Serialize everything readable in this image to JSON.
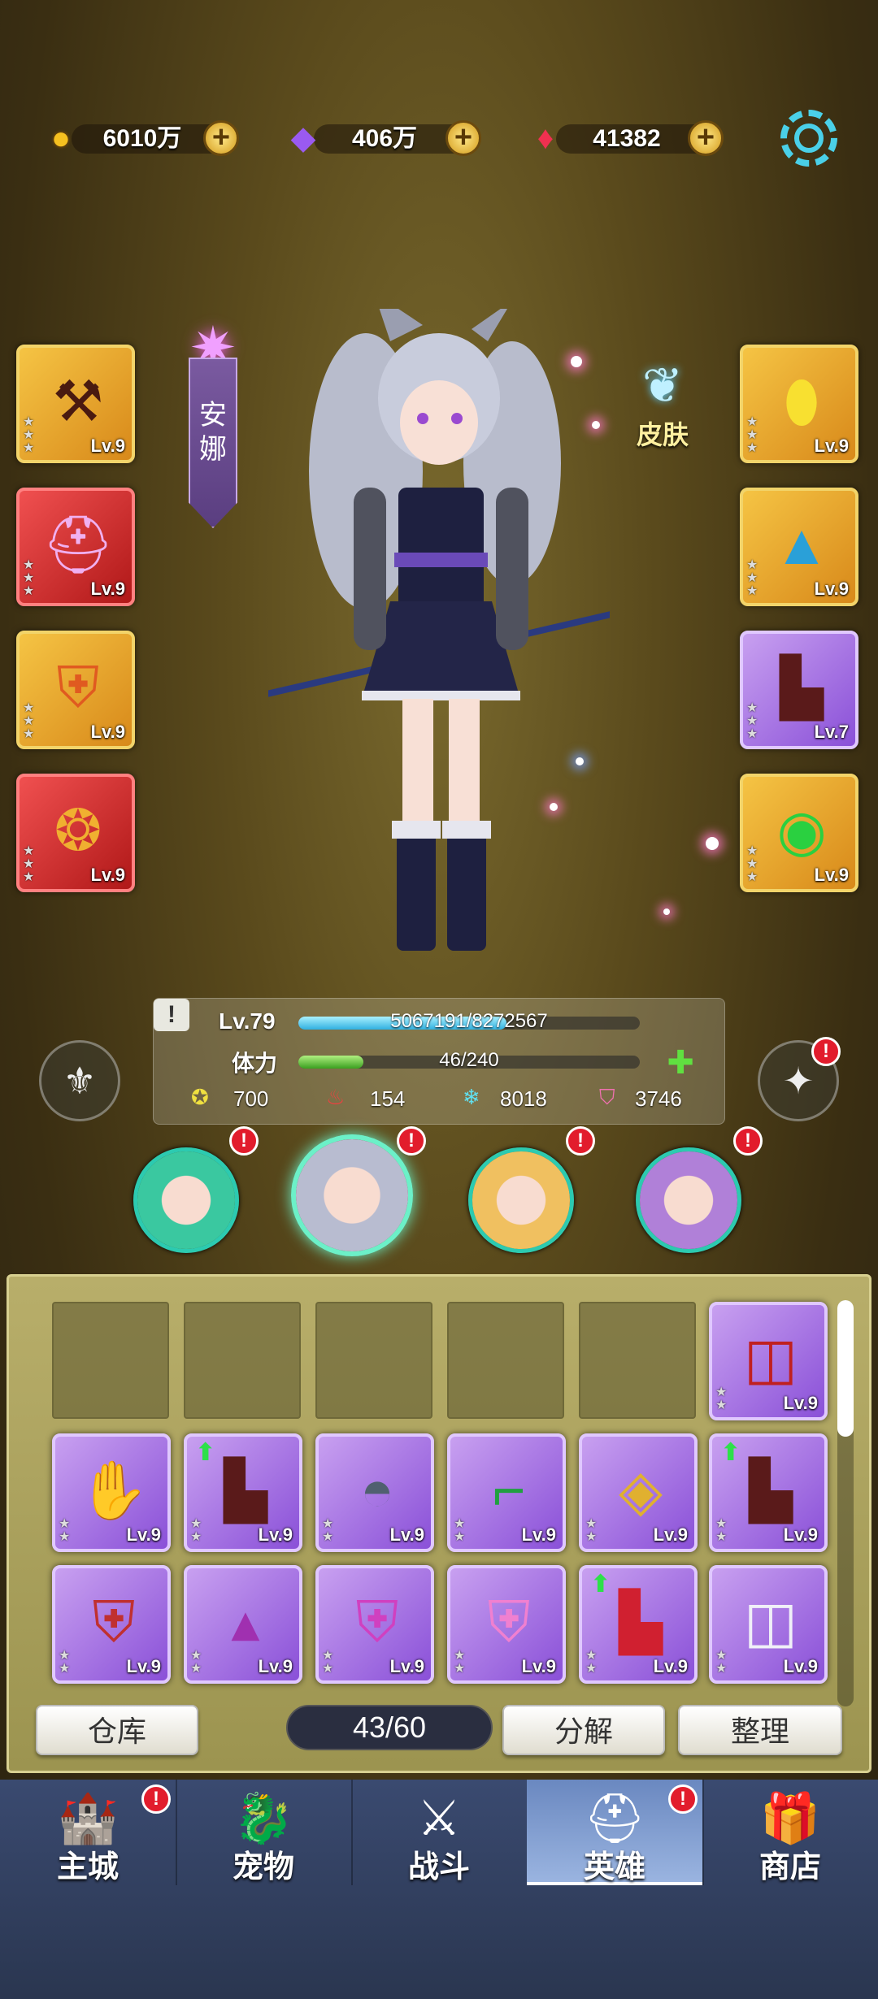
{
  "resources": [
    {
      "icon": "gold-coin-icon",
      "value": "6010万"
    },
    {
      "icon": "purple-crystal-icon",
      "value": "406万"
    },
    {
      "icon": "red-gem-icon",
      "value": "41382"
    }
  ],
  "hero": {
    "name": "安娜",
    "skin_label": "皮肤",
    "level": "Lv.79",
    "exp_text": "5067191/8272567",
    "exp_fraction": 0.61,
    "stamina_label": "体力",
    "stamina_text": "46/240",
    "stamina_fraction": 0.19,
    "attack": "700",
    "fire": "154",
    "ice": "8018",
    "defense": "3746"
  },
  "equipped_left": [
    "Lv.9",
    "Lv.9",
    "Lv.9",
    "Lv.9"
  ],
  "equipped_right": [
    "Lv.9",
    "Lv.9",
    "Lv.7",
    "Lv.9"
  ],
  "inventory": {
    "row1_last": "Lv.9",
    "row2": [
      "Lv.9",
      "Lv.9",
      "Lv.9",
      "Lv.9",
      "Lv.9",
      "Lv.9"
    ],
    "row3": [
      "Lv.9",
      "Lv.9",
      "Lv.9",
      "Lv.9",
      "Lv.9",
      "Lv.9"
    ]
  },
  "bottom_bar": {
    "warehouse": "仓库",
    "capacity": "43/60",
    "decompose": "分解",
    "sort": "整理"
  },
  "nav": [
    "主城",
    "宠物",
    "战斗",
    "英雄",
    "商店"
  ],
  "badge": "!"
}
